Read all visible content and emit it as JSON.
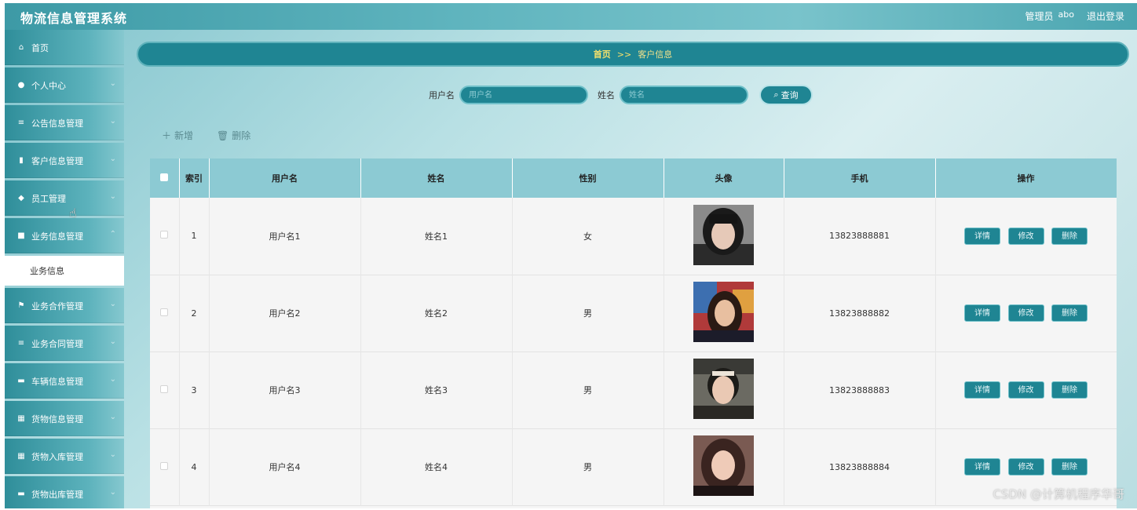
{
  "app": {
    "title": "物流信息管理系统"
  },
  "top_right": {
    "role": "管理员",
    "username": "abo",
    "logout": "退出登录"
  },
  "sidebar": {
    "items": [
      {
        "label": "首页",
        "icon": "home-icon",
        "glyph": "⌂",
        "has_chevron": false
      },
      {
        "label": "个人中心",
        "icon": "user-icon",
        "glyph": "●",
        "has_chevron": true
      },
      {
        "label": "公告信息管理",
        "icon": "list-icon",
        "glyph": "≡",
        "has_chevron": true
      },
      {
        "label": "客户信息管理",
        "icon": "bar-chart-icon",
        "glyph": "▮",
        "has_chevron": true
      },
      {
        "label": "员工管理",
        "icon": "thumbs-up-icon",
        "glyph": "◆",
        "has_chevron": true
      },
      {
        "label": "业务信息管理",
        "icon": "clipboard-icon",
        "glyph": "■",
        "has_chevron": true,
        "expanded": true
      }
    ],
    "subitem": "业务信息",
    "items_after": [
      {
        "label": "业务合作管理",
        "icon": "flag-icon",
        "glyph": "⚑",
        "has_chevron": true
      },
      {
        "label": "业务合同管理",
        "icon": "list-icon",
        "glyph": "≡",
        "has_chevron": true
      },
      {
        "label": "车辆信息管理",
        "icon": "monitor-icon",
        "glyph": "▬",
        "has_chevron": true
      },
      {
        "label": "货物信息管理",
        "icon": "grid-icon",
        "glyph": "▦",
        "has_chevron": true
      },
      {
        "label": "货物入库管理",
        "icon": "grid-icon",
        "glyph": "▦",
        "has_chevron": true
      },
      {
        "label": "货物出库管理",
        "icon": "comment-icon",
        "glyph": "▬",
        "has_chevron": true
      }
    ]
  },
  "breadcrumb": {
    "home": "首页",
    "separator": ">>",
    "current": "客户信息"
  },
  "search": {
    "username_label": "用户名",
    "username_placeholder": "用户名",
    "name_label": "姓名",
    "name_placeholder": "姓名",
    "button_label": "查询"
  },
  "actions": {
    "add": "新增",
    "delete": "删除"
  },
  "table": {
    "headers": {
      "index": "索引",
      "username": "用户名",
      "name": "姓名",
      "gender": "性别",
      "avatar": "头像",
      "phone": "手机",
      "ops": "操作"
    },
    "rows": [
      {
        "index": "1",
        "username": "用户名1",
        "name": "姓名1",
        "gender": "女",
        "phone": "13823888881"
      },
      {
        "index": "2",
        "username": "用户名2",
        "name": "姓名2",
        "gender": "男",
        "phone": "13823888882"
      },
      {
        "index": "3",
        "username": "用户名3",
        "name": "姓名3",
        "gender": "男",
        "phone": "13823888883"
      },
      {
        "index": "4",
        "username": "用户名4",
        "name": "姓名4",
        "gender": "男",
        "phone": "13823888884"
      }
    ],
    "row_buttons": {
      "detail": "详情",
      "edit": "修改",
      "delete": "删除"
    }
  },
  "watermark": "CSDN @计算机程序华哥",
  "colors": {
    "accent": "#1f8593",
    "header": "#8ccad3",
    "breadcrumb_text": "#f5e06b"
  }
}
